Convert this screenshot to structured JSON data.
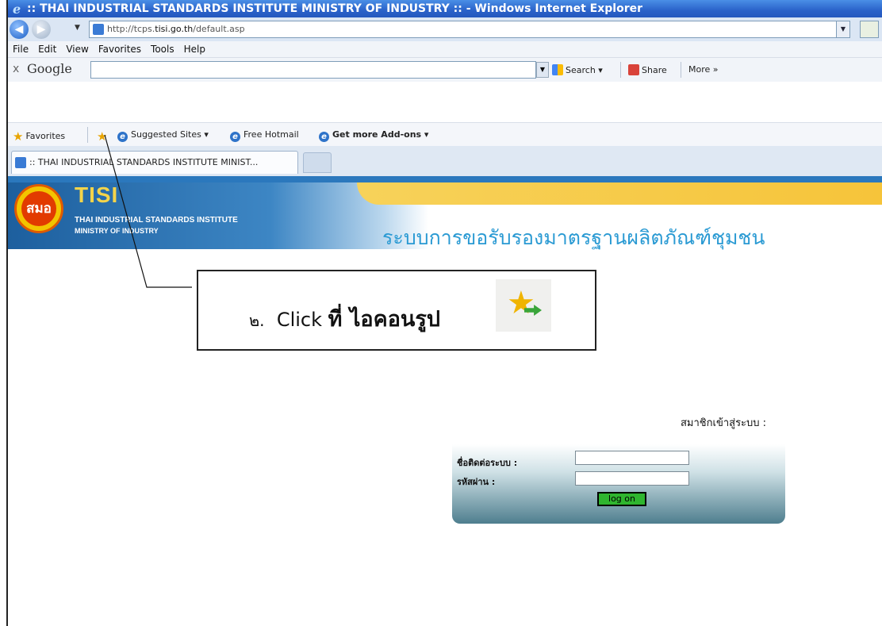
{
  "window": {
    "title": ":: THAI INDUSTRIAL STANDARDS INSTITUTE MINISTRY OF INDUSTRY :: - Windows Internet Explorer"
  },
  "address_bar": {
    "url_prefix": "http://tcps.",
    "url_domain": "tisi.go.th",
    "url_suffix": "/default.asp"
  },
  "menu": [
    "File",
    "Edit",
    "View",
    "Favorites",
    "Tools",
    "Help"
  ],
  "google_toolbar": {
    "close": "x",
    "logo": "Google",
    "search_label": "Search",
    "share_label": "Share",
    "more_label": "More »"
  },
  "favorites_bar": {
    "favorites_label": "Favorites",
    "suggested_sites": "Suggested Sites",
    "free_hotmail": "Free Hotmail",
    "get_addons": "Get more Add-ons"
  },
  "tab": {
    "label": ":: THAI INDUSTRIAL STANDARDS INSTITUTE MINIST..."
  },
  "header": {
    "logo_text": "สมอ",
    "brand": "TISI",
    "brand_line1": "THAI INDUSTRIAL STANDARDS INSTITUTE",
    "brand_line2": "MINISTRY OF INDUSTRY",
    "site_title": "ระบบการขอรับรองมาตรฐานผลิตภัณฑ์ชุมชน"
  },
  "callout": {
    "number": "๒.",
    "text_en": "Click",
    "text_th": "ที่ ไอคอนรูป"
  },
  "login": {
    "heading": "สมาชิกเข้าสู่ระบบ :",
    "username_label": "ชื่อติดต่อระบบ :",
    "password_label": "รหัสผ่าน :",
    "button_label": "log on"
  }
}
